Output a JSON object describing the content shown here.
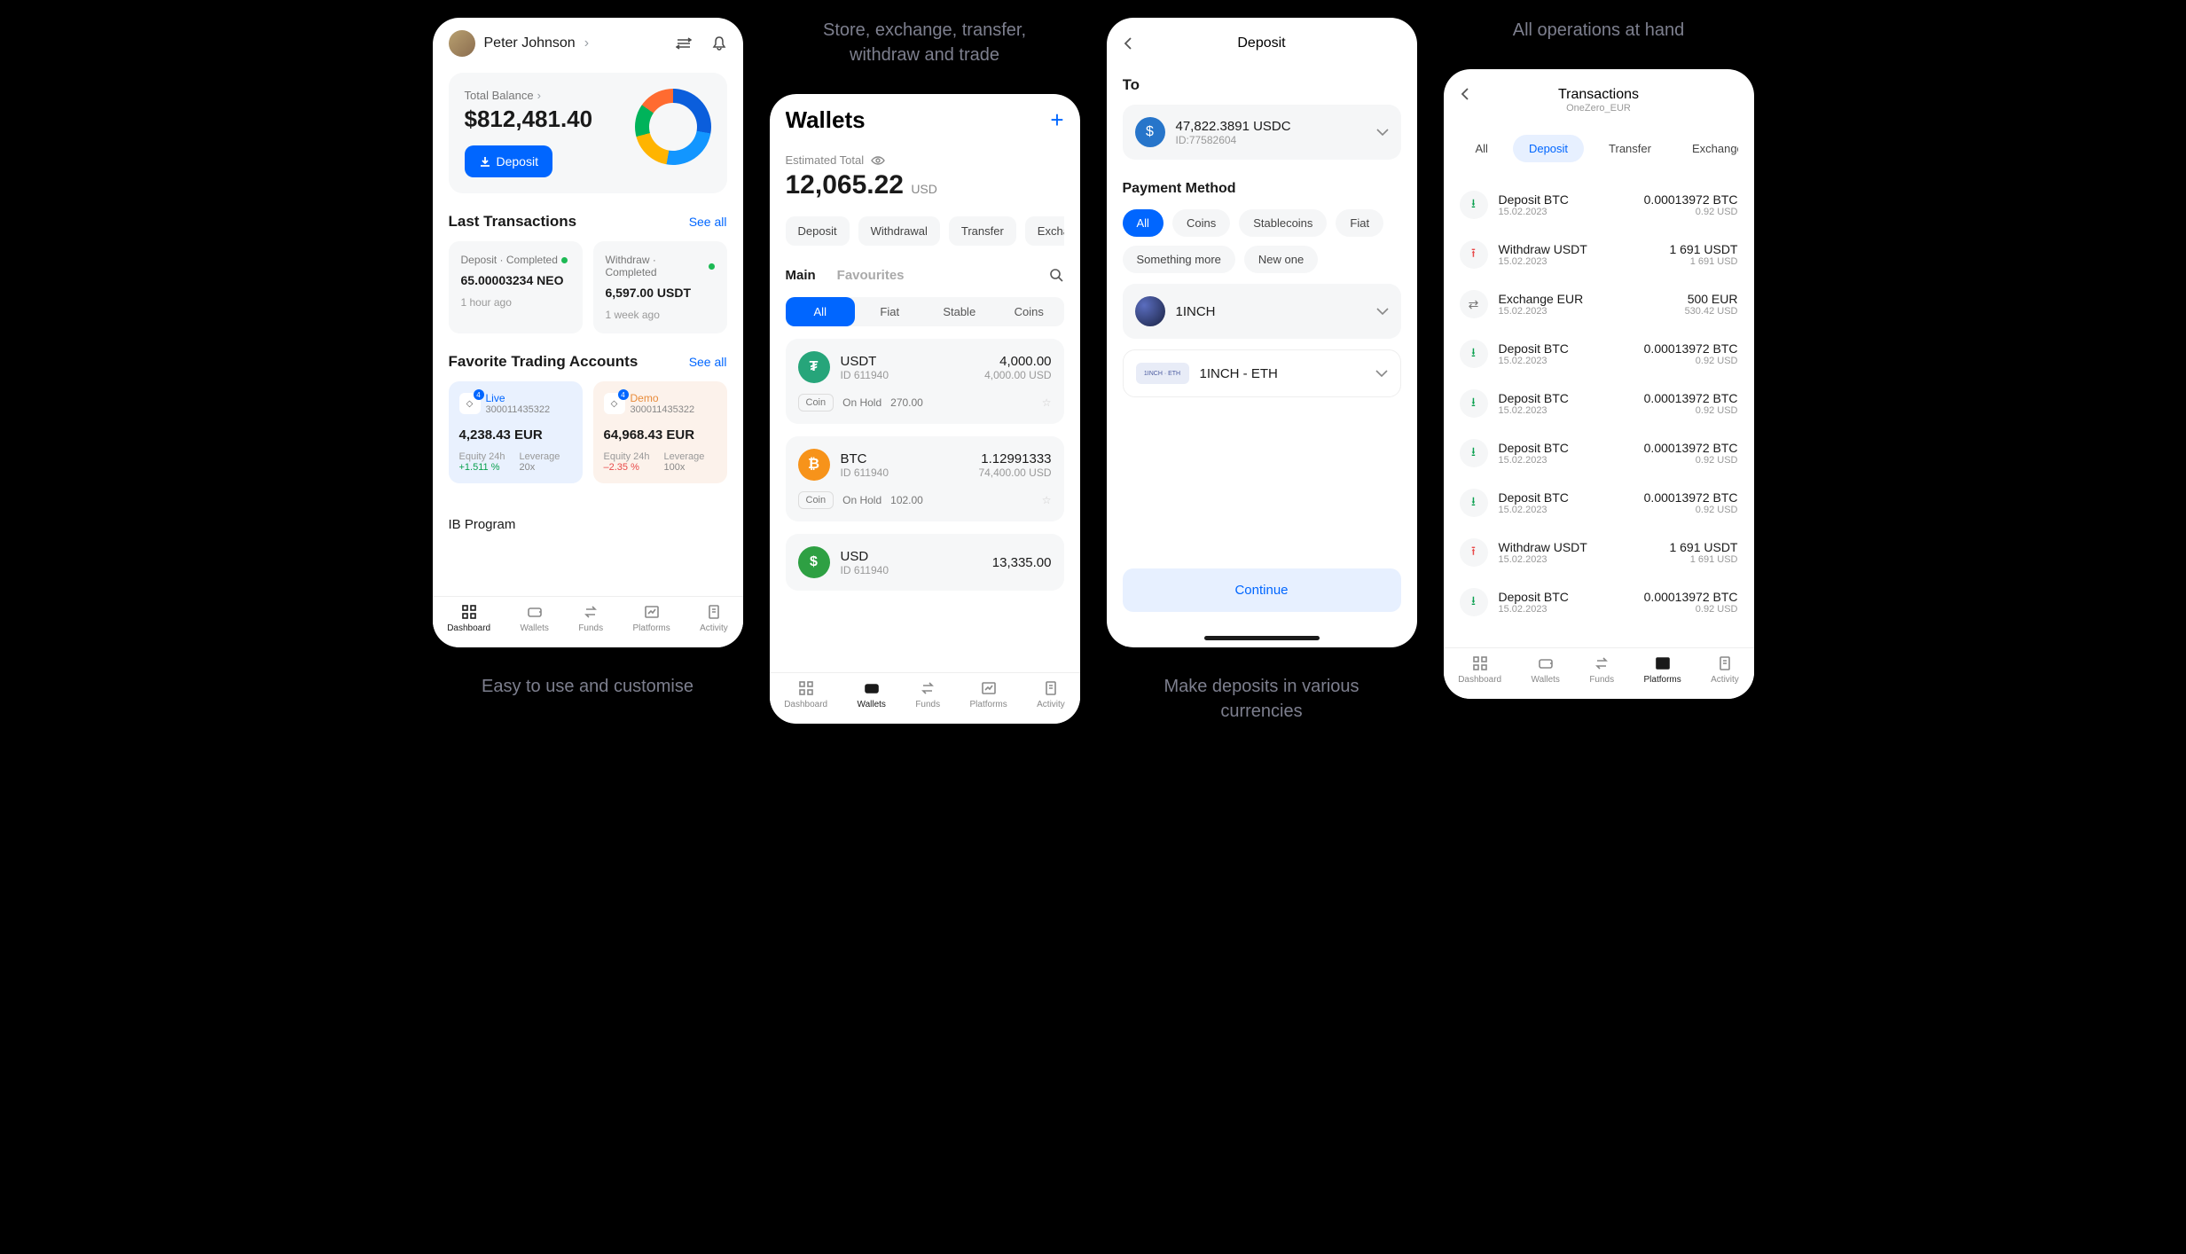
{
  "captions": {
    "c1": "Easy to use and customise",
    "c2top": "Store, exchange, transfer, withdraw and trade",
    "c3": "Make deposits in various currencies",
    "c4top": "All operations at hand"
  },
  "s1": {
    "user": "Peter Johnson",
    "balance_label": "Total Balance",
    "balance": "$812,481.40",
    "deposit_btn": "Deposit",
    "last_tx": "Last Transactions",
    "see_all": "See all",
    "tx1_top": "Deposit · Completed",
    "tx1_amt": "65.00003234 NEO",
    "tx1_time": "1 hour ago",
    "tx2_top": "Withdraw · Completed",
    "tx2_amt": "6,597.00 USDT",
    "tx2_time": "1 week ago",
    "fav_acct": "Favorite Trading Accounts",
    "acct1_name": "Live",
    "acct1_id": "300011435322",
    "acct1_badge": "4",
    "acct1_val": "4,238.43 EUR",
    "acct1_eq_label": "Equity 24h",
    "acct1_eq": "+1.511  %",
    "acct1_lev_label": "Leverage",
    "acct1_lev": "20x",
    "acct2_name": "Demo",
    "acct2_id": "300011435322",
    "acct2_badge": "4",
    "acct2_val": "64,968.43 EUR",
    "acct2_eq": "–2.35  %",
    "acct2_lev": "100x",
    "ib": "IB Program"
  },
  "s2": {
    "title": "Wallets",
    "est_label": "Estimated Total",
    "est_amt": "12,065.22",
    "est_curr": "USD",
    "pills": [
      "Deposit",
      "Withdrawal",
      "Transfer",
      "Exchange"
    ],
    "tab_main": "Main",
    "tab_fav": "Favourites",
    "seg": [
      "All",
      "Fiat",
      "Stable",
      "Coins"
    ],
    "w1_name": "USDT",
    "w1_id": "ID 611940",
    "w1_amt": "4,000.00",
    "w1_sub": "4,000.00 USD",
    "w1_hold_label": "On Hold",
    "w1_hold": "270.00",
    "coin_tag": "Coin",
    "w2_name": "BTC",
    "w2_id": "ID 611940",
    "w2_amt": "1.12991333",
    "w2_sub": "74,400.00 USD",
    "w2_hold": "102.00",
    "w3_name": "USD",
    "w3_id": "ID 611940",
    "w3_amt": "13,335.00"
  },
  "s3": {
    "title": "Deposit",
    "to": "To",
    "to_amt": "47,822.3891 USDC",
    "to_id": "ID:77582604",
    "pm": "Payment Method",
    "chips": [
      "All",
      "Coins",
      "Stablecoins",
      "Fiat",
      "Something more",
      "New one"
    ],
    "opt1": "1INCH",
    "opt2": "1INCH - ETH",
    "opt2_tag": "1INCH · ETH",
    "continue": "Continue"
  },
  "s4": {
    "title": "Transactions",
    "sub": "OneZero_EUR",
    "chips": [
      "All",
      "Deposit",
      "Transfer",
      "Exchange"
    ],
    "items": [
      {
        "t": "dep",
        "name": "Deposit BTC",
        "date": "15.02.2023",
        "amt": "0.00013972 BTC",
        "sub": "0.92 USD"
      },
      {
        "t": "wd",
        "name": "Withdraw USDT",
        "date": "15.02.2023",
        "amt": "1 691 USDT",
        "sub": "1 691 USD"
      },
      {
        "t": "ex",
        "name": "Exchange EUR",
        "date": "15.02.2023",
        "amt": "500 EUR",
        "sub": "530.42 USD"
      },
      {
        "t": "dep",
        "name": "Deposit BTC",
        "date": "15.02.2023",
        "amt": "0.00013972 BTC",
        "sub": "0.92 USD"
      },
      {
        "t": "dep",
        "name": "Deposit BTC",
        "date": "15.02.2023",
        "amt": "0.00013972 BTC",
        "sub": "0.92 USD"
      },
      {
        "t": "dep",
        "name": "Deposit BTC",
        "date": "15.02.2023",
        "amt": "0.00013972 BTC",
        "sub": "0.92 USD"
      },
      {
        "t": "dep",
        "name": "Deposit BTC",
        "date": "15.02.2023",
        "amt": "0.00013972 BTC",
        "sub": "0.92 USD"
      },
      {
        "t": "wd",
        "name": "Withdraw USDT",
        "date": "15.02.2023",
        "amt": "1 691 USDT",
        "sub": "1 691 USD"
      },
      {
        "t": "dep",
        "name": "Deposit BTC",
        "date": "15.02.2023",
        "amt": "0.00013972 BTC",
        "sub": "0.92 USD"
      }
    ]
  },
  "nav": [
    "Dashboard",
    "Wallets",
    "Funds",
    "Platforms",
    "Activity"
  ]
}
